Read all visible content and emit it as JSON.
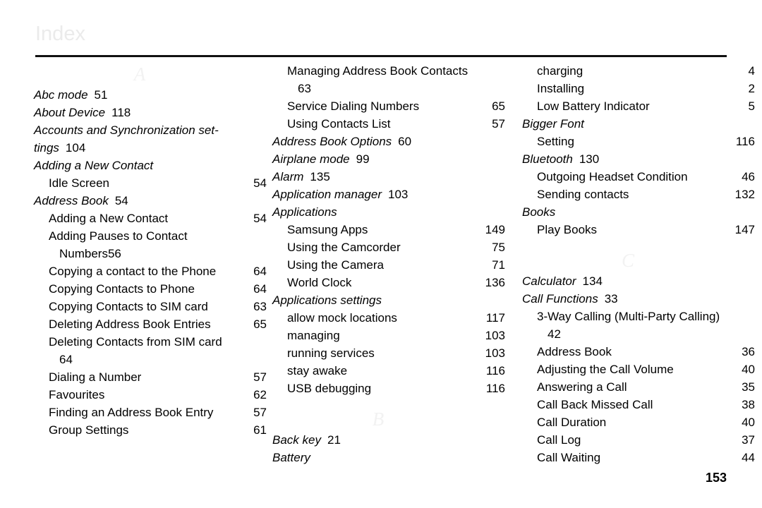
{
  "header": {
    "title": "Index"
  },
  "footer": {
    "page_number": "153"
  },
  "colors": {
    "title": "#ebebeb",
    "section_letter": "#f2f2f2",
    "rule": "#111111",
    "text": "#000000"
  },
  "columns": [
    {
      "id": "column-1",
      "blocks": [
        {
          "type": "section-letter",
          "label": "A"
        },
        {
          "type": "entry",
          "level": 0,
          "text": "Abc mode",
          "page": "51"
        },
        {
          "type": "entry",
          "level": 0,
          "text": "About Device",
          "page": "118"
        },
        {
          "type": "entry",
          "level": 0,
          "text": "Accounts and Synchronization set-",
          "page": ""
        },
        {
          "type": "entry",
          "level": 0,
          "cont": true,
          "text": "tings",
          "page": "104"
        },
        {
          "type": "entry",
          "level": 0,
          "text": "Adding a New Contact",
          "page": ""
        },
        {
          "type": "entry",
          "level": 1,
          "text": "Idle Screen",
          "page": "54"
        },
        {
          "type": "entry",
          "level": 0,
          "text": "Address Book",
          "page": "54"
        },
        {
          "type": "entry",
          "level": 1,
          "text": "Adding a New Contact",
          "page": "54"
        },
        {
          "type": "entry",
          "level": 1,
          "text": "Adding Pauses to Contact",
          "page": ""
        },
        {
          "type": "entry",
          "level": 1,
          "cont": true,
          "text": "Numbers",
          "page": "56"
        },
        {
          "type": "entry",
          "level": 1,
          "text": "Copying a contact to the Phone",
          "page": "64"
        },
        {
          "type": "entry",
          "level": 1,
          "text": "Copying Contacts to Phone",
          "page": "64"
        },
        {
          "type": "entry",
          "level": 1,
          "text": "Copying Contacts to SIM card",
          "page": "63"
        },
        {
          "type": "entry",
          "level": 1,
          "text": "Deleting Address Book Entries",
          "page": "65"
        },
        {
          "type": "entry",
          "level": 1,
          "text": "Deleting Contacts from SIM card",
          "page": ""
        },
        {
          "type": "entry",
          "level": 1,
          "cont": true,
          "text": "64",
          "page": ""
        },
        {
          "type": "entry",
          "level": 1,
          "text": "Dialing a Number",
          "page": "57"
        },
        {
          "type": "entry",
          "level": 1,
          "text": "Favourites",
          "page": "62"
        },
        {
          "type": "entry",
          "level": 1,
          "text": "Finding an Address Book Entry",
          "page": "57"
        },
        {
          "type": "entry",
          "level": 1,
          "text": "Group Settings",
          "page": "61"
        }
      ]
    },
    {
      "id": "column-2",
      "blocks": [
        {
          "type": "entry",
          "level": 1,
          "text": "Managing Address Book Contacts",
          "page": ""
        },
        {
          "type": "entry",
          "level": 1,
          "cont": true,
          "text": "63",
          "page": ""
        },
        {
          "type": "entry",
          "level": 1,
          "text": "Service Dialing Numbers",
          "page": "65"
        },
        {
          "type": "entry",
          "level": 1,
          "text": "Using Contacts List",
          "page": "57"
        },
        {
          "type": "entry",
          "level": 0,
          "text": "Address Book Options",
          "page": "60"
        },
        {
          "type": "entry",
          "level": 0,
          "text": "Airplane mode",
          "page": "99"
        },
        {
          "type": "entry",
          "level": 0,
          "text": "Alarm",
          "page": "135"
        },
        {
          "type": "entry",
          "level": 0,
          "text": "Application manager",
          "page": "103"
        },
        {
          "type": "entry",
          "level": 0,
          "text": "Applications",
          "page": ""
        },
        {
          "type": "entry",
          "level": 1,
          "text": "Samsung Apps",
          "page": "149"
        },
        {
          "type": "entry",
          "level": 1,
          "text": "Using the Camcorder",
          "page": "75"
        },
        {
          "type": "entry",
          "level": 1,
          "text": "Using the Camera",
          "page": "71"
        },
        {
          "type": "entry",
          "level": 1,
          "text": "World Clock",
          "page": "136"
        },
        {
          "type": "entry",
          "level": 0,
          "text": "Applications settings",
          "page": ""
        },
        {
          "type": "entry",
          "level": 1,
          "text": "allow mock locations",
          "page": "117"
        },
        {
          "type": "entry",
          "level": 1,
          "text": "managing",
          "page": "103"
        },
        {
          "type": "entry",
          "level": 1,
          "text": "running services",
          "page": "103"
        },
        {
          "type": "entry",
          "level": 1,
          "text": "stay awake",
          "page": "116"
        },
        {
          "type": "entry",
          "level": 1,
          "text": "USB debugging",
          "page": "116"
        },
        {
          "type": "section-letter",
          "label": "B"
        },
        {
          "type": "entry",
          "level": 0,
          "text": "Back key",
          "page": "21"
        },
        {
          "type": "entry",
          "level": 0,
          "text": "Battery",
          "page": ""
        }
      ]
    },
    {
      "id": "column-3",
      "blocks": [
        {
          "type": "entry",
          "level": 1,
          "text": "charging",
          "page": "4"
        },
        {
          "type": "entry",
          "level": 1,
          "text": "Installing",
          "page": "2"
        },
        {
          "type": "entry",
          "level": 1,
          "text": "Low Battery Indicator",
          "page": "5"
        },
        {
          "type": "entry",
          "level": 0,
          "text": "Bigger Font",
          "page": ""
        },
        {
          "type": "entry",
          "level": 1,
          "text": "Setting",
          "page": "116"
        },
        {
          "type": "entry",
          "level": 0,
          "text": "Bluetooth",
          "page": "130"
        },
        {
          "type": "entry",
          "level": 1,
          "text": "Outgoing Headset Condition",
          "page": "46"
        },
        {
          "type": "entry",
          "level": 1,
          "text": "Sending contacts",
          "page": "132"
        },
        {
          "type": "entry",
          "level": 0,
          "text": "Books",
          "page": ""
        },
        {
          "type": "entry",
          "level": 1,
          "text": "Play Books",
          "page": "147"
        },
        {
          "type": "section-letter",
          "label": "C"
        },
        {
          "type": "entry",
          "level": 0,
          "text": "Calculator",
          "page": "134"
        },
        {
          "type": "entry",
          "level": 0,
          "text": "Call Functions",
          "page": "33"
        },
        {
          "type": "entry",
          "level": 1,
          "text": "3-Way Calling (Multi-Party Calling)",
          "page": ""
        },
        {
          "type": "entry",
          "level": 1,
          "cont": true,
          "text": "42",
          "page": ""
        },
        {
          "type": "entry",
          "level": 1,
          "text": "Address Book",
          "page": "36"
        },
        {
          "type": "entry",
          "level": 1,
          "text": "Adjusting the Call Volume",
          "page": "40"
        },
        {
          "type": "entry",
          "level": 1,
          "text": "Answering a Call",
          "page": "35"
        },
        {
          "type": "entry",
          "level": 1,
          "text": "Call Back Missed Call",
          "page": "38"
        },
        {
          "type": "entry",
          "level": 1,
          "text": "Call Duration",
          "page": "40"
        },
        {
          "type": "entry",
          "level": 1,
          "text": "Call Log",
          "page": "37"
        },
        {
          "type": "entry",
          "level": 1,
          "text": "Call Waiting",
          "page": "44"
        }
      ]
    }
  ]
}
